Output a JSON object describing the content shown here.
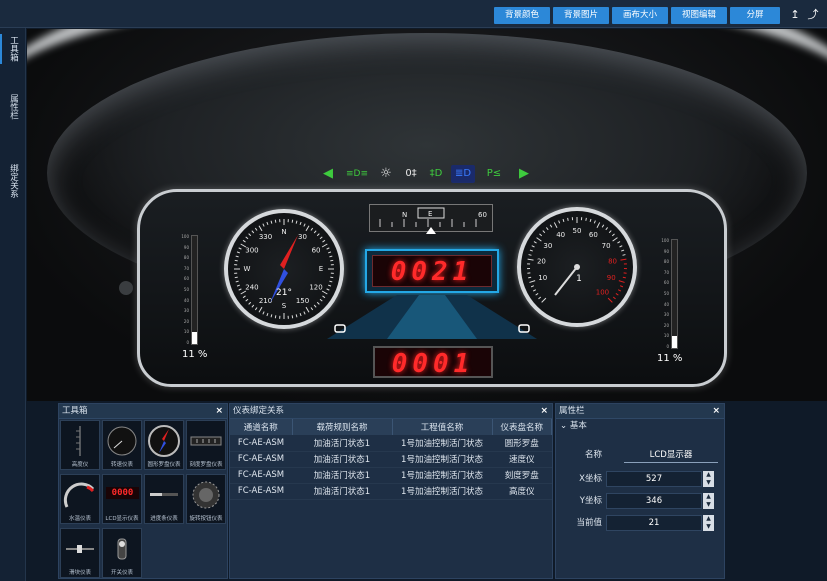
{
  "toolbar": {
    "buttons": [
      "背景颜色",
      "背景图片",
      "画布大小",
      "视图编辑",
      "分屏"
    ],
    "up_arrow": "↥",
    "export_arrow": "⤴"
  },
  "side_tabs": [
    "工具箱",
    "属性栏",
    "绑定关系"
  ],
  "dashboard": {
    "compass_heading": "21°",
    "compass_labels": [
      "N",
      "30",
      "60",
      "E",
      "120",
      "150",
      "S",
      "210",
      "240",
      "W",
      "300",
      "330"
    ],
    "speed_ticks": [
      "10",
      "20",
      "30",
      "40",
      "50",
      "60",
      "70",
      "80",
      "90",
      "100"
    ],
    "speed_value": "1",
    "lcd_main": "0021",
    "lcd_secondary": "0001",
    "left_bar_percent": "11 %",
    "right_bar_percent": "11 %",
    "left_bar_fill": 0.11,
    "right_bar_fill": 0.11,
    "bar_ticks": [
      "100",
      "90",
      "80",
      "70",
      "60",
      "50",
      "40",
      "30",
      "20",
      "10",
      "0"
    ],
    "compass_strip_labels": [
      "N",
      "E",
      "60"
    ],
    "warning_colors": {
      "arrow": "#3ecb3e",
      "lamp": "#3ecb3e",
      "beam": "#3a7bff",
      "hazard": "#e8e8e8"
    }
  },
  "toolbox": {
    "title": "工具箱",
    "close": "×",
    "tools": [
      "高度仪",
      "转速仪表",
      "圆形罗盘仪表",
      "刻度罗盘仪表",
      "水温仪表",
      "LCD显示仪表",
      "进度条仪表",
      "旋转按钮仪表",
      "滑块仪表",
      "开关仪表"
    ],
    "lcd_thumb_text": "0000"
  },
  "bindings": {
    "title": "仪表绑定关系",
    "close": "×",
    "columns": [
      "通道名称",
      "载荷规则名称",
      "工程值名称",
      "仪表盘名称"
    ],
    "rows": [
      [
        "FC-AE-ASM",
        "加油活门状态1",
        "1号加油控制活门状态",
        "圆形罗盘"
      ],
      [
        "FC-AE-ASM",
        "加油活门状态1",
        "1号加油控制活门状态",
        "速度仪"
      ],
      [
        "FC-AE-ASM",
        "加油活门状态1",
        "1号加油控制活门状态",
        "刻度罗盘"
      ],
      [
        "FC-AE-ASM",
        "加油活门状态1",
        "1号加油控制活门状态",
        "高度仪"
      ]
    ]
  },
  "properties": {
    "title": "属性栏",
    "close": "×",
    "section": "基本",
    "name_label": "名称",
    "name_value": "LCD显示器",
    "x_label": "X坐标",
    "x_value": "527",
    "y_label": "Y坐标",
    "y_value": "346",
    "current_label": "当前值",
    "current_value": "21"
  }
}
